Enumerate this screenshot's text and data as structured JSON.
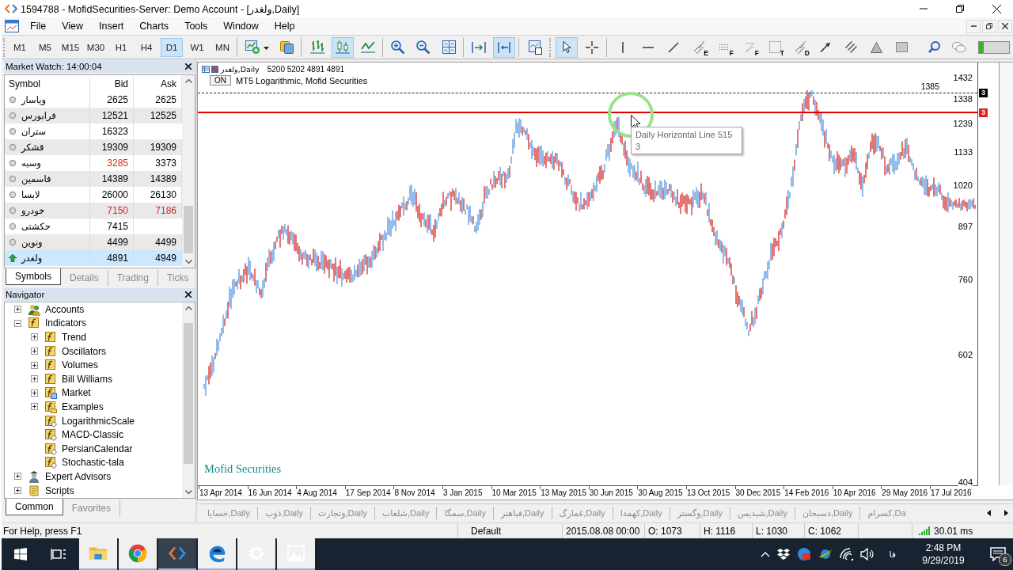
{
  "window": {
    "title": "1594788 - MofidSecurities-Server: Demo Account - [ولغدر,Daily]"
  },
  "menu": [
    "File",
    "View",
    "Insert",
    "Charts",
    "Tools",
    "Window",
    "Help"
  ],
  "toolbar": {
    "timeframes": [
      {
        "label": "M1",
        "selected": false
      },
      {
        "label": "M5",
        "selected": false
      },
      {
        "label": "M15",
        "selected": false
      },
      {
        "label": "M30",
        "selected": false
      },
      {
        "label": "H1",
        "selected": false
      },
      {
        "label": "H4",
        "selected": false
      },
      {
        "label": "D1",
        "selected": true
      },
      {
        "label": "W1",
        "selected": false
      },
      {
        "label": "MN",
        "selected": false
      }
    ],
    "buttons": [
      {
        "selected": false
      },
      {
        "selected": false
      },
      {
        "selected": false
      },
      {
        "selected": true
      },
      {
        "selected": false
      },
      {
        "selected": false
      },
      {
        "selected": false
      },
      {
        "selected": false
      },
      {
        "selected": false
      },
      {
        "selected": true
      },
      {
        "selected": false
      },
      {
        "selected": true
      },
      {
        "selected": false
      },
      {
        "selected": false
      },
      {
        "selected": false
      },
      {
        "selected": false
      },
      {
        "selected": false,
        "label": "E"
      },
      {
        "selected": false,
        "label": "F"
      },
      {
        "selected": false,
        "label": "F"
      },
      {
        "selected": false,
        "label": "T"
      },
      {
        "selected": false,
        "label": "D"
      },
      {
        "selected": false
      },
      {
        "selected": false
      },
      {
        "selected": false
      },
      {
        "selected": false
      },
      {
        "selected": false
      },
      {
        "selected": false
      }
    ],
    "meter": {
      "level": 0.17
    }
  },
  "market_watch": {
    "title": "Market Watch: 14:00:04",
    "columns": [
      "Symbol",
      "Bid",
      "Ask"
    ],
    "rows": [
      {
        "symbol": "ویاسار",
        "bid": "2625",
        "ask": "2625",
        "rising": false,
        "bid_down": false,
        "ask_down": false,
        "selected": false
      },
      {
        "symbol": "فرابورس",
        "bid": "12521",
        "ask": "12525",
        "rising": false,
        "bid_down": false,
        "ask_down": false,
        "selected": false
      },
      {
        "symbol": "ستران",
        "bid": "16323",
        "rising": false,
        "bid_down": false,
        "selected": false
      },
      {
        "symbol": "قشکر",
        "bid": "19309",
        "ask": "19309",
        "rising": false,
        "bid_down": false,
        "ask_down": false,
        "selected": false
      },
      {
        "symbol": "وسبه",
        "bid": "3285",
        "ask": "3373",
        "rising": false,
        "bid_down": true,
        "ask_down": false,
        "selected": false
      },
      {
        "symbol": "فاسمین",
        "bid": "14389",
        "ask": "14389",
        "rising": false,
        "bid_down": false,
        "ask_down": false,
        "selected": false
      },
      {
        "symbol": "لابسا",
        "bid": "26000",
        "ask": "26130",
        "rising": false,
        "bid_down": false,
        "ask_down": false,
        "selected": false
      },
      {
        "symbol": "خودرو",
        "bid": "7150",
        "ask": "7186",
        "rising": false,
        "bid_down": true,
        "ask_down": true,
        "selected": false
      },
      {
        "symbol": "حکشتی",
        "bid": "7415",
        "rising": false,
        "bid_down": false,
        "selected": false
      },
      {
        "symbol": "ونوین",
        "bid": "4499",
        "ask": "4499",
        "rising": false,
        "bid_down": false,
        "ask_down": false,
        "selected": false
      },
      {
        "symbol": "ولغدر",
        "bid": "4891",
        "ask": "4949",
        "rising": true,
        "bid_down": false,
        "ask_down": false,
        "selected": true
      }
    ],
    "tabs": [
      {
        "label": "Symbols",
        "selected": true
      },
      {
        "label": "Details",
        "selected": false
      },
      {
        "label": "Trading",
        "selected": false
      },
      {
        "label": "Ticks",
        "selected": false
      }
    ]
  },
  "navigator": {
    "title": "Navigator",
    "tree": [
      {
        "label": "Accounts",
        "kind": "accounts",
        "expanded": false
      },
      {
        "label": "Indicators",
        "kind": "group",
        "expanded": true,
        "children": [
          {
            "label": "Trend",
            "kind": "group",
            "expanded": false
          },
          {
            "label": "Oscillators",
            "kind": "group",
            "expanded": false
          },
          {
            "label": "Volumes",
            "kind": "group",
            "expanded": false
          },
          {
            "label": "Bill Williams",
            "kind": "group",
            "expanded": false
          },
          {
            "label": "Market",
            "kind": "market",
            "expanded": false
          },
          {
            "label": "Examples",
            "kind": "examples",
            "expanded": false
          },
          {
            "label": "LogarithmicScale",
            "kind": "custom"
          },
          {
            "label": "MACD-Classic",
            "kind": "custom"
          },
          {
            "label": "PersianCalendar",
            "kind": "custom"
          },
          {
            "label": "Stochastic-tala",
            "kind": "custom"
          }
        ]
      },
      {
        "label": "Expert Advisors",
        "kind": "experts",
        "expanded": false
      },
      {
        "label": "Scripts",
        "kind": "scripts",
        "expanded": false
      }
    ],
    "tabs": [
      {
        "label": "Common",
        "selected": true
      },
      {
        "label": "Favorites",
        "selected": false
      }
    ]
  },
  "chart": {
    "symbol": "ولغدر,Daily",
    "quote": "5200 5202 4891 4891",
    "indicator": {
      "button": "ON",
      "name": "MT5 Logarithmic, Mofid Securities"
    },
    "price_labels": [
      "1432",
      "1338",
      "1239",
      "1133",
      "1020",
      "897",
      "760",
      "602",
      "404"
    ],
    "dotted_line": {
      "label": "1385",
      "tag": "3"
    },
    "red_line": {
      "tag": "3"
    },
    "tooltip": [
      "Daily Horizontal Line 515",
      "3"
    ],
    "caption": "Mofid Securities",
    "date_labels": [
      "13 Apr 2014",
      "16 Jun 2014",
      "4 Aug 2014",
      "17 Sep 2014",
      "8 Nov 2014",
      "3 Jan 2015",
      "10 Mar 2015",
      "13 May 2015",
      "30 Jun 2015",
      "30 Aug 2015",
      "13 Oct 2015",
      "30 Dec 2015",
      "14 Feb 2016",
      "10 Apr 2016",
      "29 May 2016",
      "17 Jul 2016"
    ]
  },
  "chart_tabs": [
    {
      "label": "خسایا,Daily",
      "selected": false
    },
    {
      "label": "ذوب,Daily",
      "selected": false
    },
    {
      "label": "وتجارت,Daily",
      "selected": false
    },
    {
      "label": "شلعاب,Daily",
      "selected": false
    },
    {
      "label": "سمگا,Daily",
      "selected": false
    },
    {
      "label": "فباهنر,Daily",
      "selected": false
    },
    {
      "label": "غمارگ,Daily",
      "selected": false
    },
    {
      "label": "کهمدا,Daily",
      "selected": false
    },
    {
      "label": "وگستر,Daily",
      "selected": false
    },
    {
      "label": "شبدیس,Daily",
      "selected": false
    },
    {
      "label": "دسبحان,Daily",
      "selected": false
    },
    {
      "label": "کسرام,Da",
      "selected": false
    }
  ],
  "status_bar": {
    "help": "For Help, press F1",
    "profile": "Default",
    "time": "2015.08.08 00:00",
    "open": "O: 1073",
    "high": "H: 1116",
    "low": "L: 1030",
    "close": "C: 1062",
    "ping": "30.01 ms"
  },
  "taskbar": {
    "apps": [
      {
        "running": true,
        "selected": false
      },
      {
        "running": true,
        "selected": false
      },
      {
        "running": true,
        "selected": true
      },
      {
        "running": true,
        "selected": false
      },
      {
        "running": true,
        "selected": false
      },
      {
        "running": true,
        "selected": false
      }
    ],
    "language": "فا",
    "time": "2:48 PM",
    "date": "9/29/2019",
    "notifications": "6"
  }
}
